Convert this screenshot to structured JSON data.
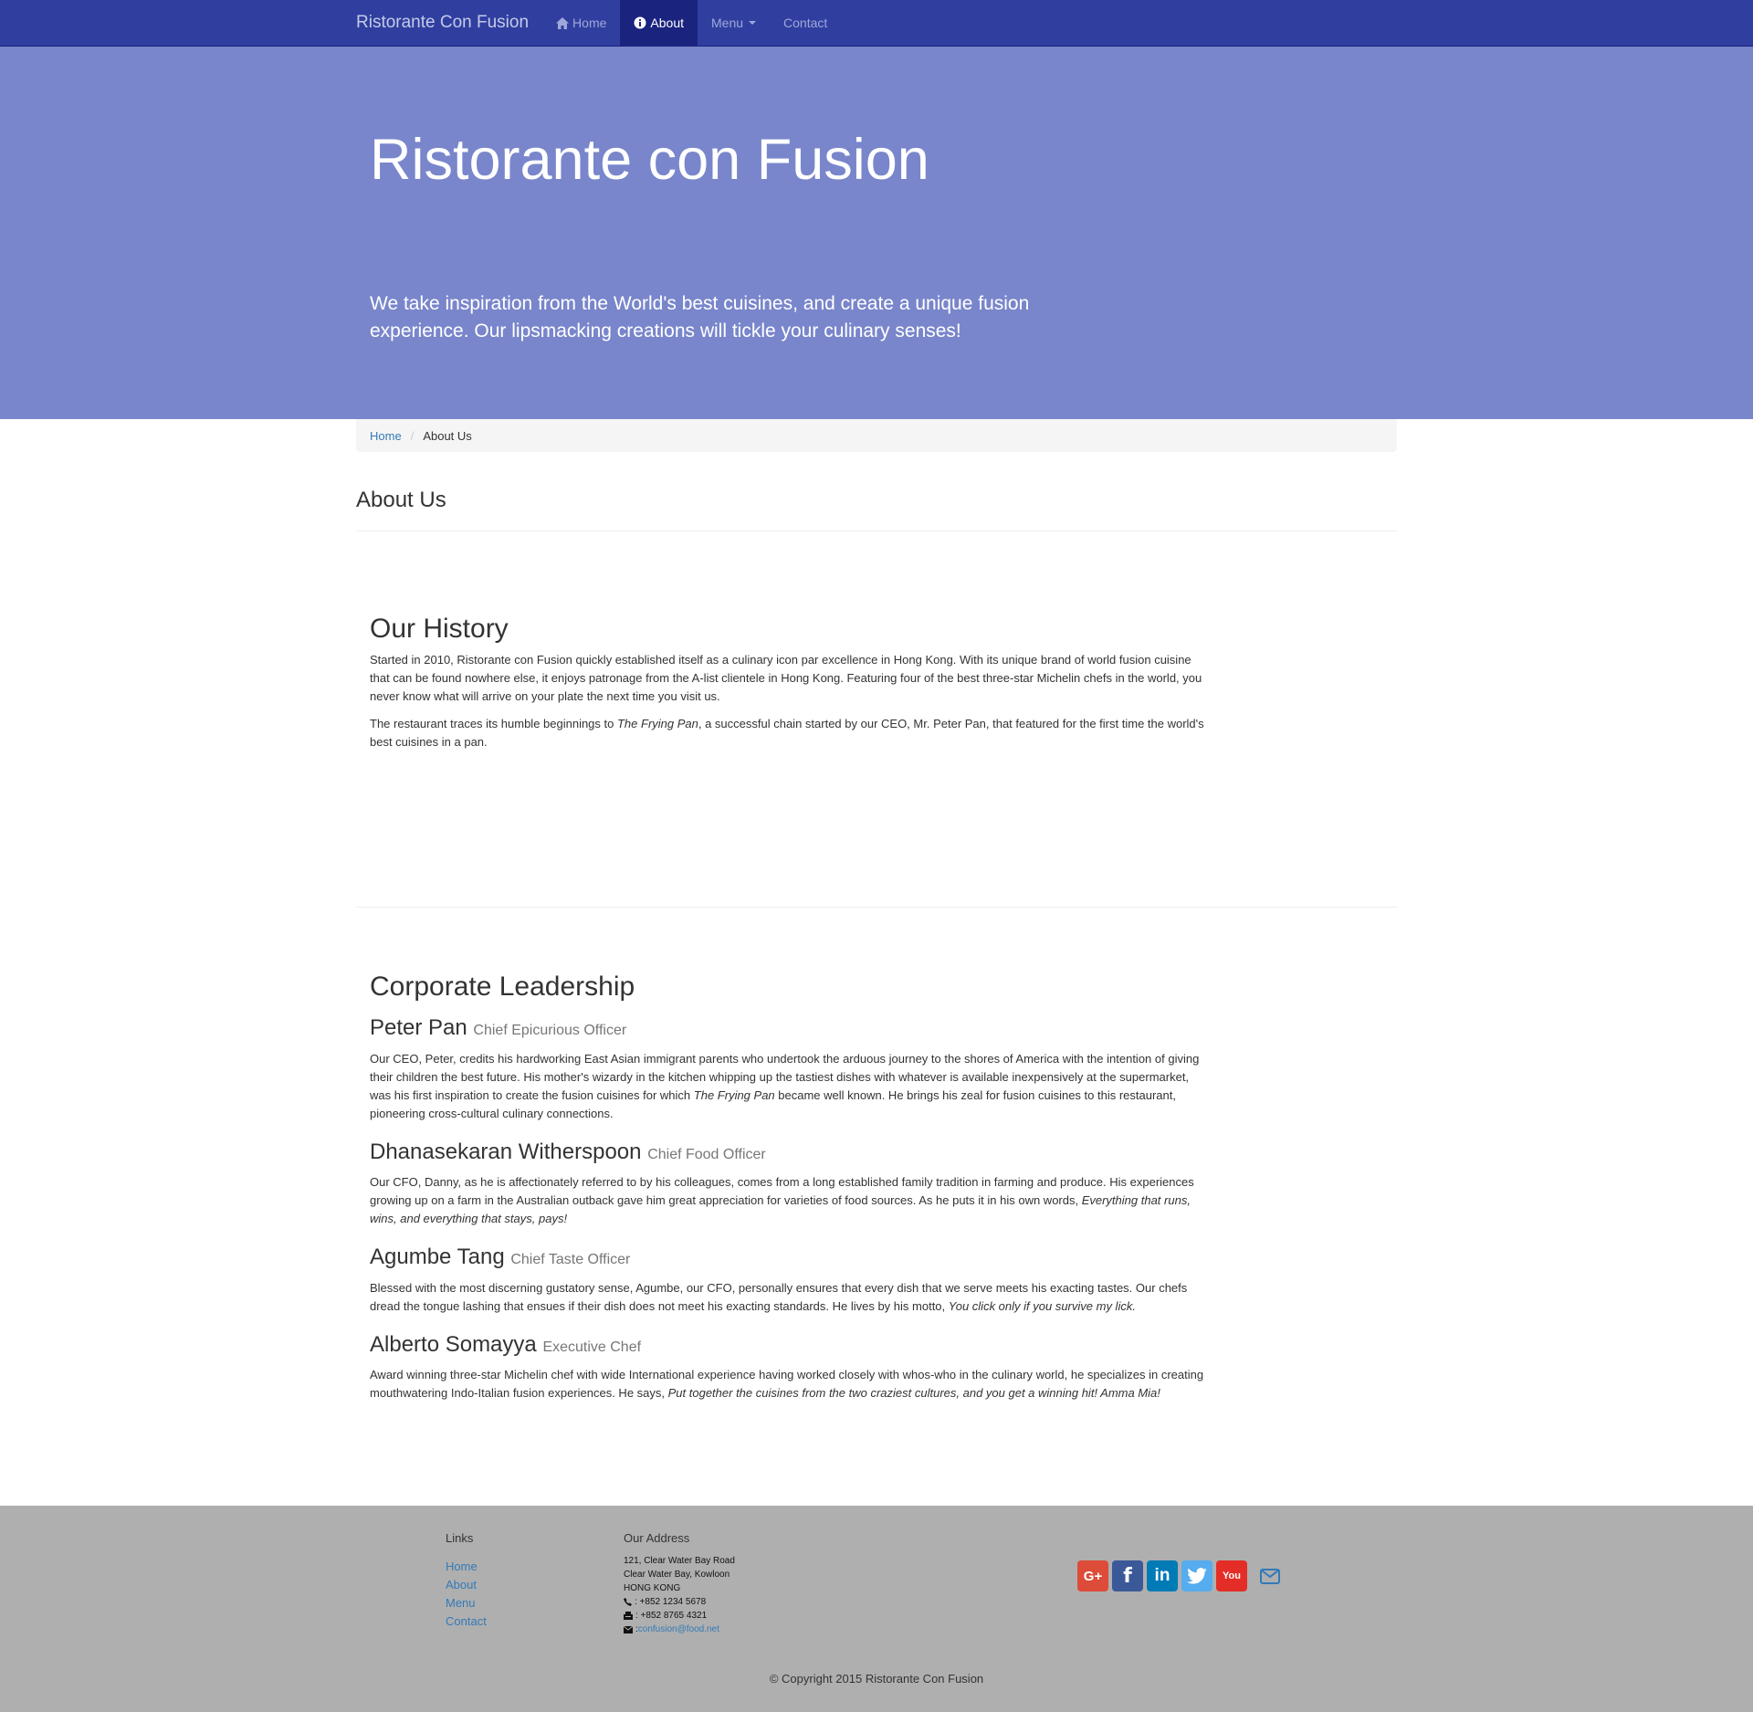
{
  "navbar": {
    "brand": "Ristorante Con Fusion",
    "items": [
      {
        "label": "Home",
        "icon": "home-icon"
      },
      {
        "label": "About",
        "icon": "info-circle-icon",
        "active": true
      },
      {
        "label": "Menu",
        "icon": "caret-down-icon"
      },
      {
        "label": "Contact"
      }
    ]
  },
  "jumbotron": {
    "title": "Ristorante con Fusion",
    "tagline": "We take inspiration from the World's best cuisines, and create a unique fusion experience. Our lipsmacking creations will tickle your culinary senses!"
  },
  "breadcrumb": {
    "home": "Home",
    "current": "About Us"
  },
  "page": {
    "title": "About Us"
  },
  "history": {
    "heading": "Our History",
    "p1": "Started in 2010, Ristorante con Fusion quickly established itself as a culinary icon par excellence in Hong Kong. With its unique brand of world fusion cuisine that can be found nowhere else, it enjoys patronage from the A-list clientele in Hong Kong. Featuring four of the best three-star Michelin chefs in the world, you never know what will arrive on your plate the next time you visit us.",
    "p2_before": "The restaurant traces its humble beginnings to ",
    "p2_em": "The Frying Pan",
    "p2_after": ", a successful chain started by our CEO, Mr. Peter Pan, that featured for the first time the world's best cuisines in a pan."
  },
  "leadership": {
    "heading": "Corporate Leadership",
    "people": [
      {
        "name": "Peter Pan",
        "role": "Chief Epicurious Officer",
        "text_before": "Our CEO, Peter, credits his hardworking East Asian immigrant parents who undertook the arduous journey to the shores of America with the intention of giving their children the best future. His mother's wizardy in the kitchen whipping up the tastiest dishes with whatever is available inexpensively at the supermarket, was his first inspiration to create the fusion cuisines for which ",
        "text_em": "The Frying Pan",
        "text_after": " became well known. He brings his zeal for fusion cuisines to this restaurant, pioneering cross-cultural culinary connections."
      },
      {
        "name": "Dhanasekaran Witherspoon",
        "role": "Chief Food Officer",
        "text_before": "Our CFO, Danny, as he is affectionately referred to by his colleagues, comes from a long established family tradition in farming and produce. His experiences growing up on a farm in the Australian outback gave him great appreciation for varieties of food sources. As he puts it in his own words, ",
        "text_em": "Everything that runs, wins, and everything that stays, pays!",
        "text_after": ""
      },
      {
        "name": "Agumbe Tang",
        "role": "Chief Taste Officer",
        "text_before": "Blessed with the most discerning gustatory sense, Agumbe, our CFO, personally ensures that every dish that we serve meets his exacting tastes. Our chefs dread the tongue lashing that ensues if their dish does not meet his exacting standards. He lives by his motto, ",
        "text_em": "You click only if you survive my lick.",
        "text_after": ""
      },
      {
        "name": "Alberto Somayya",
        "role": "Executive Chef",
        "text_before": "Award winning three-star Michelin chef with wide International experience having worked closely with whos-who in the culinary world, he specializes in creating mouthwatering Indo-Italian fusion experiences. He says, ",
        "text_em": "Put together the cuisines from the two craziest cultures, and you get a winning hit! Amma Mia!",
        "text_after": ""
      }
    ]
  },
  "footer": {
    "links_heading": "Links",
    "links": [
      "Home",
      "About",
      "Menu",
      "Contact"
    ],
    "address_heading": "Our Address",
    "address_lines": [
      "121, Clear Water Bay Road",
      "Clear Water Bay, Kowloon",
      "HONG KONG"
    ],
    "phone": ": +852 1234 5678",
    "fax": ": +852 8765 4321",
    "email_prefix": ":",
    "email": "confusion@food.net",
    "social": [
      {
        "name": "google-plus-icon",
        "color": "#dd4b39",
        "glyph": "G+"
      },
      {
        "name": "facebook-icon",
        "color": "#3b5998",
        "glyph": "f"
      },
      {
        "name": "linkedin-icon",
        "color": "#007bb6",
        "glyph": "in"
      },
      {
        "name": "twitter-icon",
        "color": "#55acee",
        "glyph": ""
      },
      {
        "name": "youtube-icon",
        "color": "#e52d27",
        "glyph": "You"
      }
    ],
    "copyright": "© Copyright 2015 Ristorante Con Fusion"
  }
}
